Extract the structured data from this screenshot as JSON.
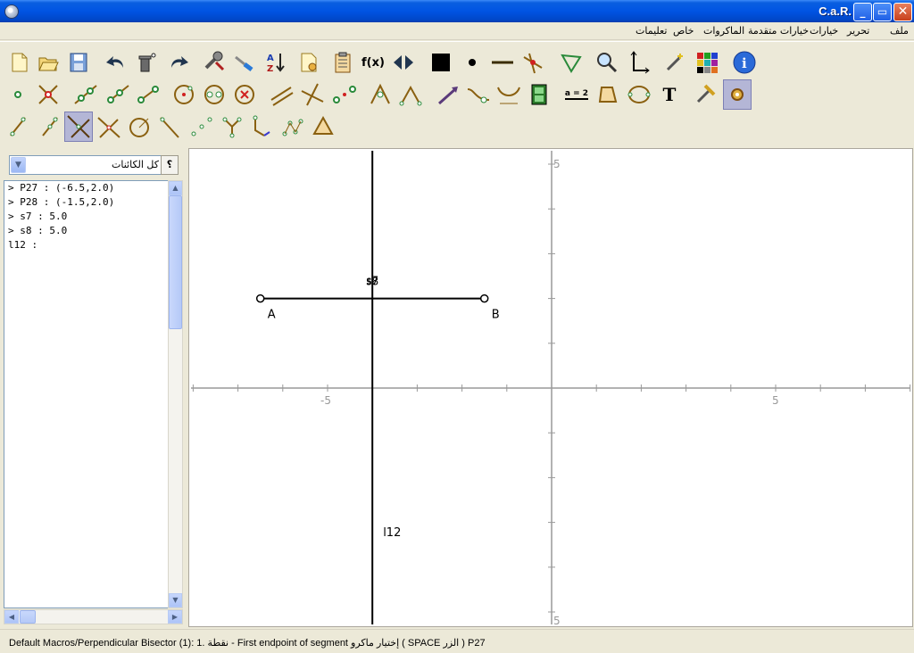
{
  "window": {
    "title": "C.a.R.",
    "minimize_label": "_",
    "maximize_label": "▭",
    "close_label": "✕"
  },
  "menu": {
    "file": "ملف",
    "edit": "تحرير",
    "options": "خيارات",
    "advanced_options": "خيارات متقدمة",
    "macros": "الماكروات",
    "special": "خاص",
    "help": "تعليمات"
  },
  "toolbar": {
    "fx_label": "f(x)",
    "text_tool_label": "T",
    "equals_label": "a = 2"
  },
  "object_panel": {
    "filter_value": "كل الكائنات",
    "help_label": "؟",
    "lines": [
      "> P27 : (-6.5,2.0)",
      "> P28 : (-1.5,2.0)",
      "> s7 : 5.0",
      "> s8 : 5.0",
      "l12 :"
    ]
  },
  "construction": {
    "points": [
      {
        "name": "A",
        "x": -6.5,
        "y": 2.0
      },
      {
        "name": "B",
        "x": -1.5,
        "y": 2.0
      }
    ],
    "segment_label": "s7",
    "segment_label_2": "s8",
    "line_label": "l12",
    "line_x": -4.0,
    "axis_ticks": {
      "x_neg": "-5",
      "x_pos": "5",
      "y_pos": "5",
      "y_neg": "5"
    },
    "colors": {
      "axis": "#999999",
      "object": "#000000"
    }
  },
  "status": {
    "text": "Default Macros/Perpendicular Bisector (1): 1. نقطة - First endpoint of segment   إختيار  ماكرو ( SPACE الزر  ) P27"
  }
}
